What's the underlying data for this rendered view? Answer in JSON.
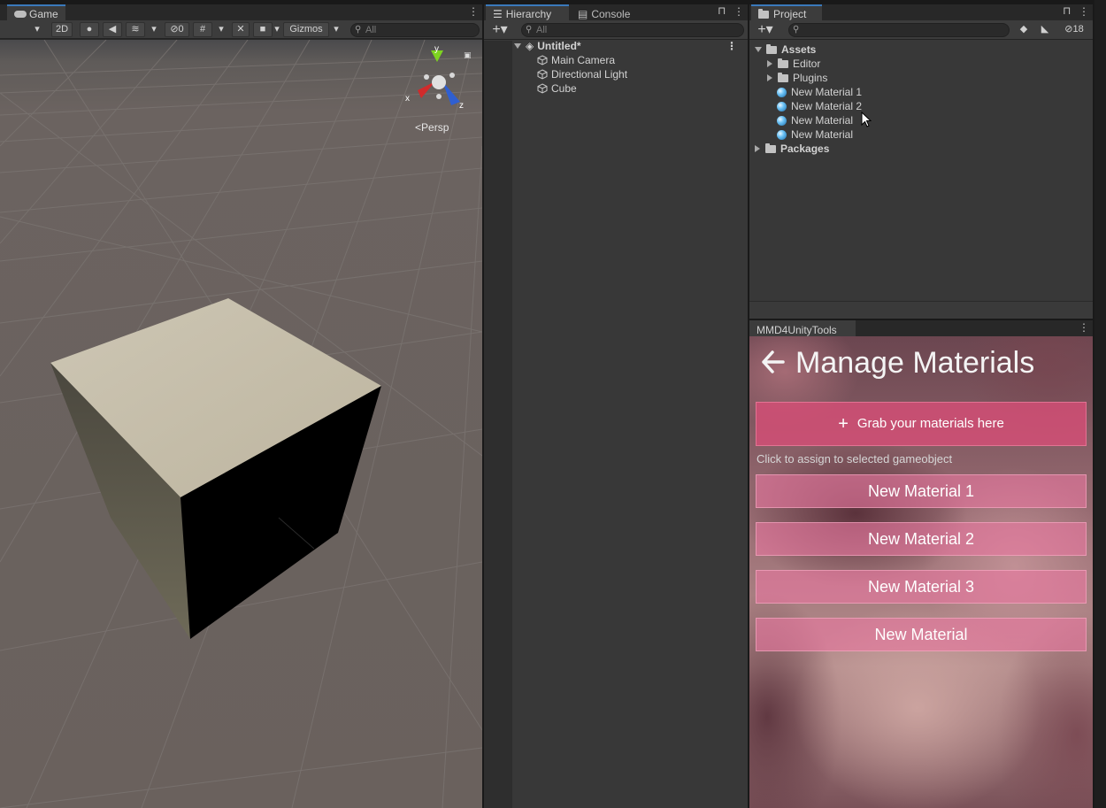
{
  "game": {
    "tab_label": "Game",
    "toolbar": {
      "btn_2d": "2D",
      "hidden_count": "0",
      "gizmos_label": "Gizmos",
      "search_placeholder": "All"
    },
    "persp_label": "Persp",
    "axis_y": "y",
    "axis_x": "x",
    "axis_z": "z"
  },
  "hierarchy": {
    "tab_label": "Hierarchy",
    "console_tab_label": "Console",
    "search_placeholder": "All",
    "scene_name": "Untitled*",
    "items": [
      {
        "label": "Main Camera"
      },
      {
        "label": "Directional Light"
      },
      {
        "label": "Cube"
      }
    ]
  },
  "project": {
    "tab_label": "Project",
    "hidden_count": "18",
    "assets_label": "Assets",
    "children": [
      {
        "label": "Editor",
        "kind": "folder"
      },
      {
        "label": "Plugins",
        "kind": "folder"
      },
      {
        "label": "New Material 1",
        "kind": "material"
      },
      {
        "label": "New Material 2",
        "kind": "material"
      },
      {
        "label": "New Material",
        "kind": "material"
      },
      {
        "label": "New Material",
        "kind": "material"
      }
    ],
    "packages_label": "Packages"
  },
  "mmd": {
    "tab_label": "MMD4UnityTools",
    "title": "Manage Materials",
    "grab_label": "Grab your materials here",
    "hint": "Click to assign to selected gameobject",
    "materials": [
      {
        "label": "New Material 1"
      },
      {
        "label": "New Material 2"
      },
      {
        "label": "New Material 3"
      },
      {
        "label": "New Material"
      }
    ]
  },
  "colors": {
    "accent_tab": "#3a79bb",
    "panel_bg": "#383838",
    "grab_button": "#d64e76",
    "material_button": "#e878a0"
  }
}
